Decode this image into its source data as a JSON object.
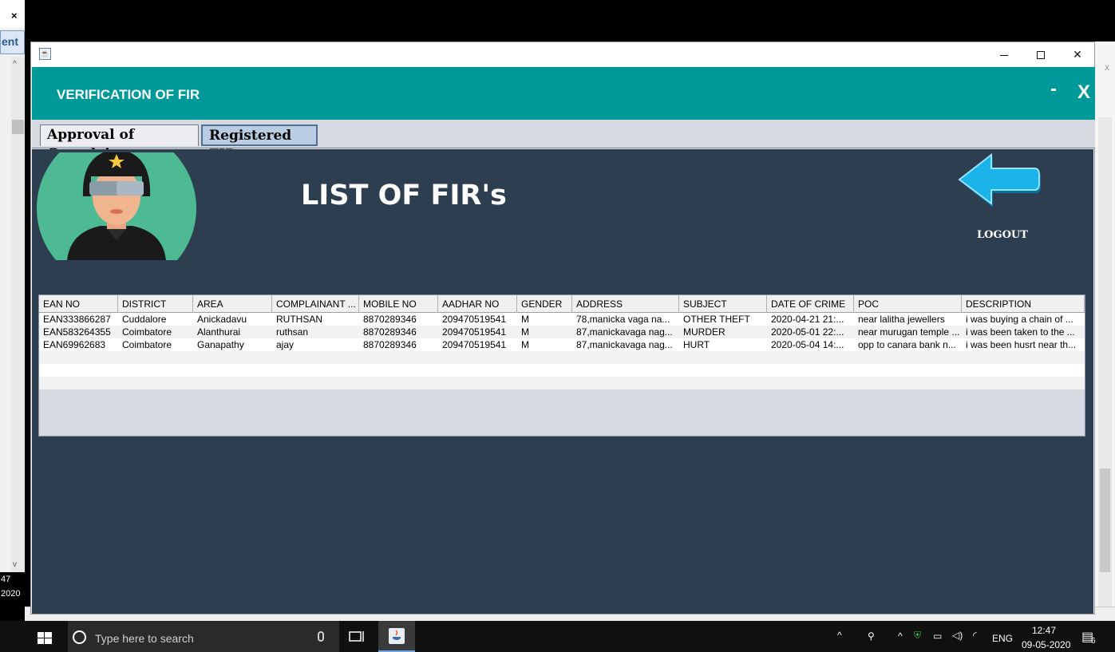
{
  "background": {
    "left_tab_text": "ent",
    "left_close": "×",
    "left_clock_lines": [
      "47",
      "2020"
    ]
  },
  "window": {
    "title_icon": "java-icon",
    "controls": {
      "minimize": "minimize-icon",
      "maximize": "maximize-icon",
      "close": "close-icon"
    }
  },
  "header": {
    "title": "VERIFICATION OF FIR",
    "min_label": "-",
    "close_label": "X",
    "accent_color": "#009999"
  },
  "tabs": [
    {
      "label": "Approval of Complain",
      "selected": false
    },
    {
      "label": "Registered FIR",
      "selected": true
    }
  ],
  "panel": {
    "title": "LIST OF FIR's",
    "logout_label": "LOGOUT",
    "background_color": "#2d3e50"
  },
  "table": {
    "columns": [
      "EAN NO",
      "DISTRICT",
      "AREA",
      "COMPLAINANT ...",
      "MOBILE NO",
      "AADHAR NO",
      "GENDER",
      "ADDRESS",
      "SUBJECT",
      "DATE OF CRIME",
      "POC",
      "DESCRIPTION"
    ],
    "rows": [
      [
        "EAN333866287",
        "Cuddalore",
        "Anickadavu",
        "RUTHSAN",
        "8870289346",
        "209470519541",
        "M",
        "78,manicka vaga na...",
        "OTHER THEFT",
        "2020-04-21 21:...",
        "near lalitha jewellers",
        "i was buying a chain of ..."
      ],
      [
        "EAN583264355",
        "Coimbatore",
        "Alanthurai",
        "ruthsan",
        "8870289346",
        "209470519541",
        "M",
        "87,manickavaga nag...",
        "MURDER",
        "2020-05-01 22:...",
        "near murugan temple ...",
        "i was been taken to the ..."
      ],
      [
        "EAN69962683",
        "Coimbatore",
        "Ganapathy",
        "ajay",
        "8870289346",
        "209470519541",
        "M",
        "87,manickavaga nag...",
        "HURT",
        "2020-05-04 14:...",
        "opp to canara bank n...",
        "i was been husrt near th..."
      ]
    ]
  },
  "taskbar": {
    "search_placeholder": "Type here to search",
    "language": "ENG",
    "time": "12:47",
    "date": "09-05-2020",
    "notification_count": "6"
  }
}
